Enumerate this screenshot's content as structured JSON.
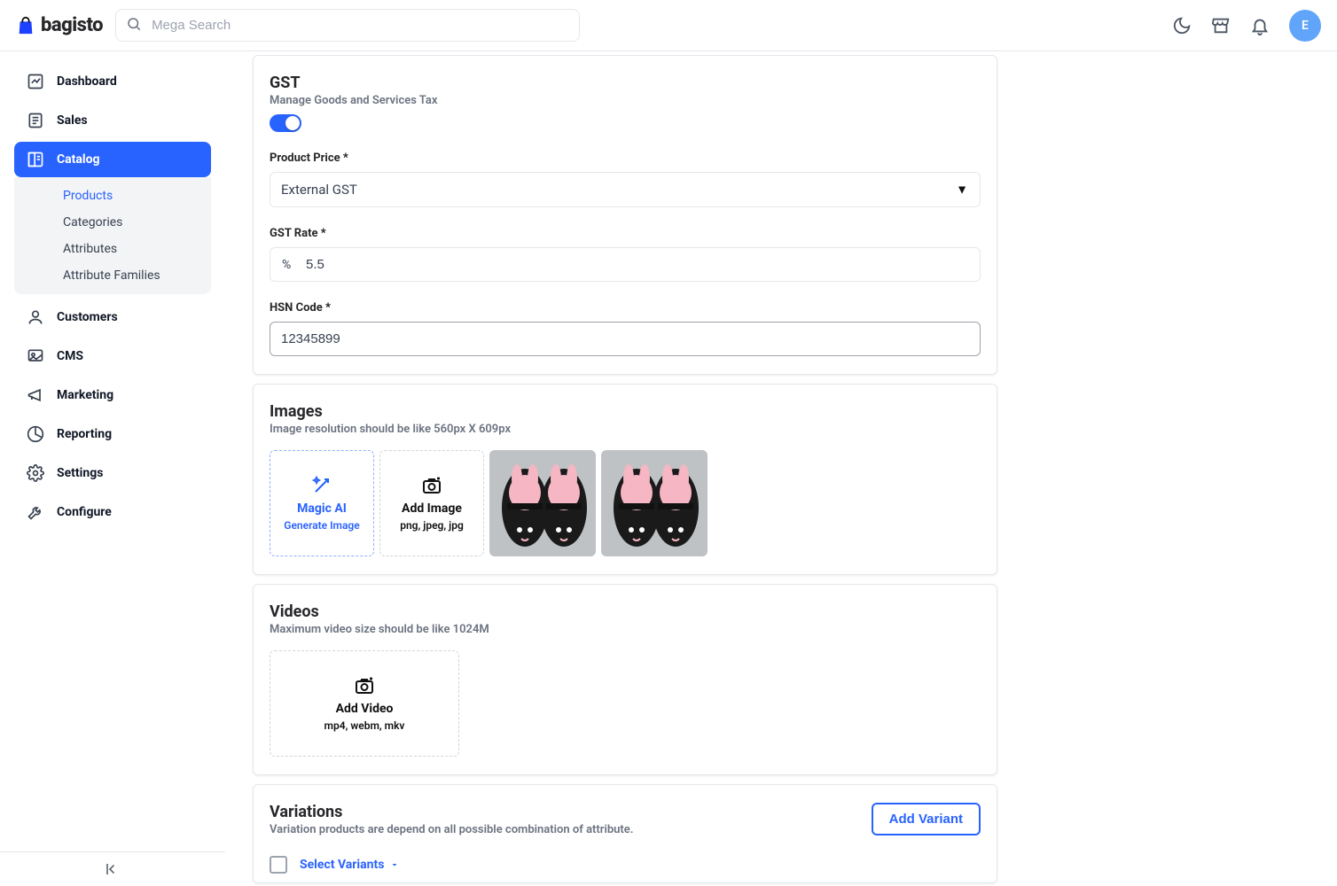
{
  "header": {
    "brand": "bagisto",
    "search_placeholder": "Mega Search",
    "avatar_initial": "E"
  },
  "sidebar": {
    "items": [
      {
        "label": "Dashboard"
      },
      {
        "label": "Sales"
      },
      {
        "label": "Catalog",
        "active": true,
        "sub": [
          {
            "label": "Products",
            "active": true
          },
          {
            "label": "Categories"
          },
          {
            "label": "Attributes"
          },
          {
            "label": "Attribute Families"
          }
        ]
      },
      {
        "label": "Customers"
      },
      {
        "label": "CMS"
      },
      {
        "label": "Marketing"
      },
      {
        "label": "Reporting"
      },
      {
        "label": "Settings"
      },
      {
        "label": "Configure"
      }
    ]
  },
  "gst": {
    "title": "GST",
    "subtitle": "Manage Goods and Services Tax",
    "enabled": true,
    "product_price_label": "Product Price",
    "product_price_value": "External GST",
    "rate_label": "GST Rate",
    "rate_affix": "%",
    "rate_value": "5.5",
    "hsn_label": "HSN Code",
    "hsn_value": "12345899"
  },
  "images": {
    "title": "Images",
    "subtitle": "Image resolution should be like 560px X 609px",
    "magic_title": "Magic AI",
    "magic_sub": "Generate Image",
    "add_title": "Add Image",
    "add_sub": "png, jpeg, jpg"
  },
  "videos": {
    "title": "Videos",
    "subtitle": "Maximum video size should be like 1024M",
    "add_title": "Add Video",
    "add_sub": "mp4, webm, mkv"
  },
  "variations": {
    "title": "Variations",
    "subtitle": "Variation products are depend on all possible combination of attribute.",
    "add_button": "Add Variant",
    "select_label": "Select Variants"
  }
}
